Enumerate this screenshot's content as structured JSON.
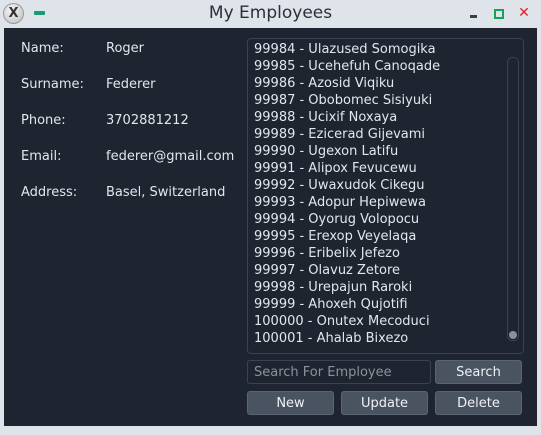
{
  "window": {
    "title": "My Employees",
    "app_icon": "X",
    "close_glyph": "✕"
  },
  "form": {
    "name_label": "Name:",
    "name_value": "Roger",
    "surname_label": "Surname:",
    "surname_value": "Federer",
    "phone_label": "Phone:",
    "phone_value": "3702881212",
    "email_label": "Email:",
    "email_value": "federer@gmail.com",
    "address_label": "Address:",
    "address_value": "Basel, Switzerland"
  },
  "employees": [
    "99984 - Ulazused Somogika",
    "99985 - Ucehefuh Canoqade",
    "99986 - Azosid Viqiku",
    "99987 - Obobomec Sisiyuki",
    "99988 - Ucixif Noxaya",
    "99989 - Ezicerad Gijevami",
    "99990 - Ugexon Latifu",
    "99991 - Alipox Fevucewu",
    "99992 - Uwaxudok Cikegu",
    "99993 - Adopur Hepiwewa",
    "99994 - Oyorug Volopocu",
    "99995 - Erexop Veyelaqa",
    "99996 - Eribelix Jefezo",
    "99997 - Olavuz Zetore",
    "99998 - Urepajun Raroki",
    "99999 - Ahoxeh Qujotifi",
    "100000 - Onutex Mecoduci",
    "100001 - Ahalab Bixezo"
  ],
  "search": {
    "placeholder": "Search For Employee",
    "value": "",
    "button_label": "Search"
  },
  "actions": {
    "new_label": "New",
    "update_label": "Update",
    "delete_label": "Delete"
  },
  "colors": {
    "background": "#1e2530",
    "button": "#4a5461",
    "text": "#e2e6ee",
    "accent_minimize": "#1b9a7a",
    "maximize": "#17a05a",
    "close": "#e0202a"
  }
}
